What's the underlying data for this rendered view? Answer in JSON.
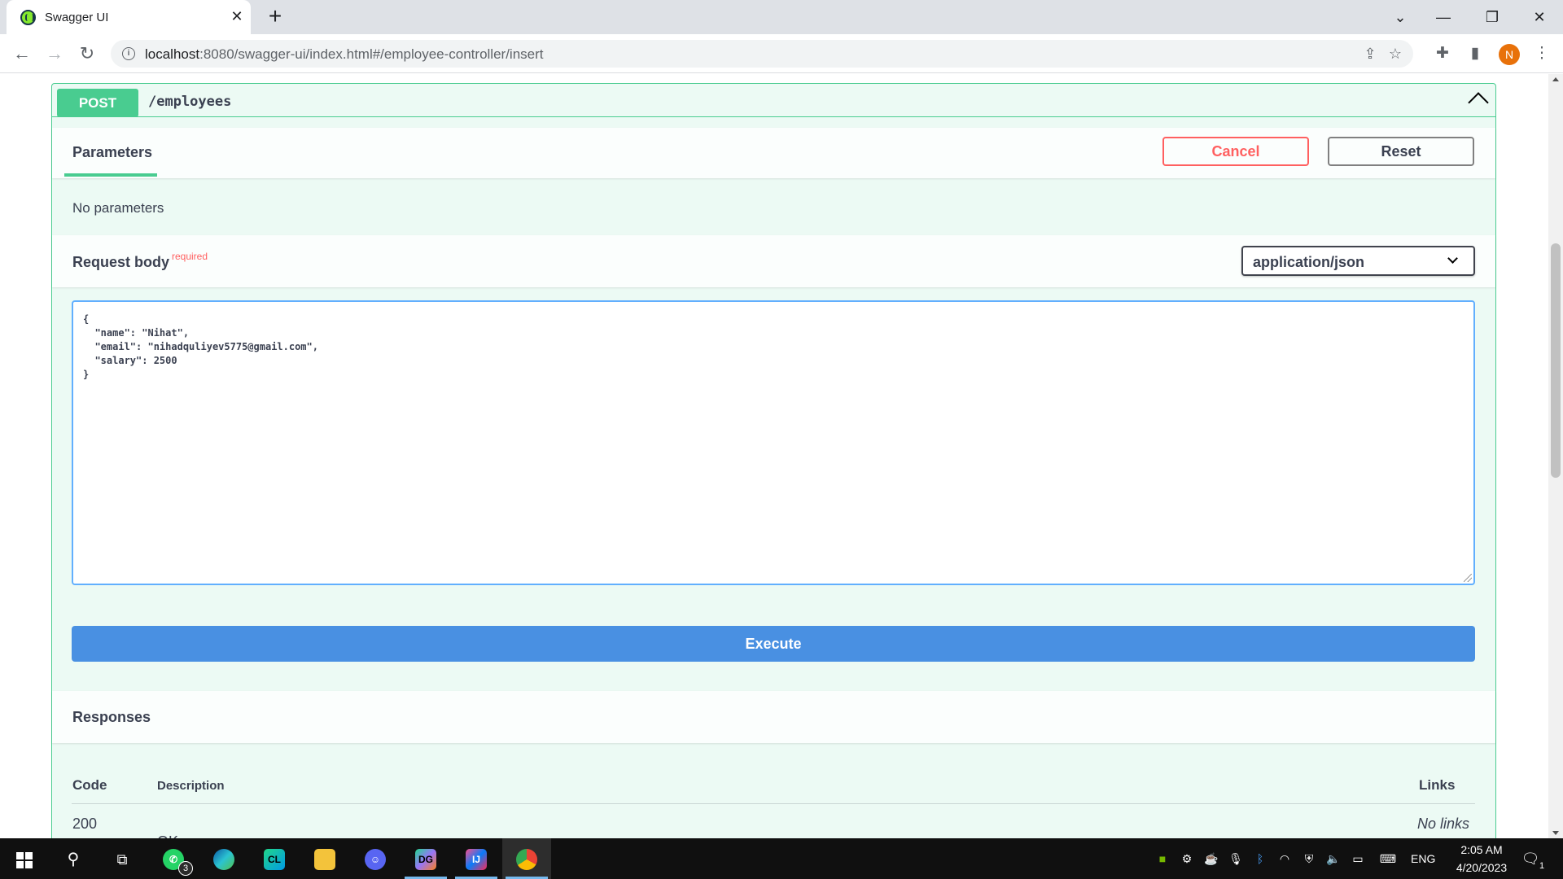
{
  "browser": {
    "tab_title": "Swagger UI",
    "tab_close": "✕",
    "new_tab": "+",
    "url_host": "localhost",
    "url_rest": ":8080/swagger-ui/index.html#/employee-controller/insert",
    "window": {
      "minimize": "—",
      "maximize": "❐",
      "close": "✕",
      "tab_search": "⌄"
    }
  },
  "operation": {
    "method": "POST",
    "path": "/employees",
    "tab_label": "Parameters",
    "cancel_label": "Cancel",
    "reset_label": "Reset",
    "no_params": "No parameters",
    "request_body_title": "Request body",
    "required_label": "required",
    "content_type": "application/json",
    "request_body": "{\n  \"name\": \"Nihat\",\n  \"email\": \"nihadquliyev5775@gmail.com\",\n  \"salary\": 2500\n}",
    "execute_label": "Execute"
  },
  "responses": {
    "title": "Responses",
    "columns": {
      "code": "Code",
      "description": "Description",
      "links": "Links"
    },
    "rows": [
      {
        "code": "200",
        "description": "OK",
        "links": "No links"
      }
    ]
  },
  "taskbar": {
    "whatsapp_badge": "3",
    "language": "ENG",
    "time": "2:05 AM",
    "date": "4/20/2023",
    "notifications": "1",
    "apps": {
      "clion": "CL",
      "datagrip": "DG",
      "intellij": "IJ"
    }
  },
  "colors": {
    "post": "#49cc90",
    "cancel": "#ff6060",
    "execute": "#4990e2",
    "editor_border": "#61affe"
  }
}
